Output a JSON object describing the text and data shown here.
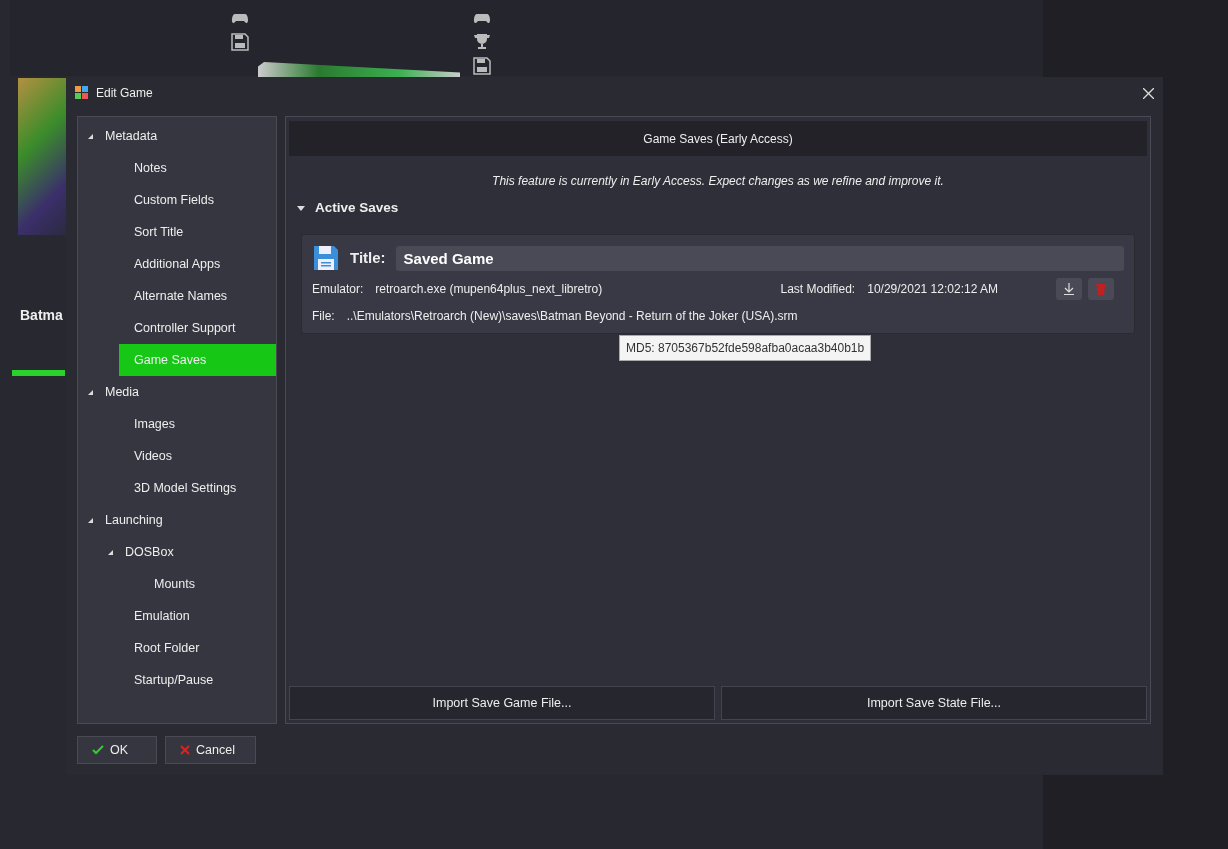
{
  "background": {
    "card_title": "Batma"
  },
  "window": {
    "title": "Edit Game"
  },
  "sidebar": {
    "items": [
      {
        "label": "Metadata",
        "expanded": true,
        "selected": false,
        "children": [
          {
            "label": "Notes",
            "selected": false
          },
          {
            "label": "Custom Fields",
            "selected": false
          },
          {
            "label": "Sort Title",
            "selected": false
          },
          {
            "label": "Additional Apps",
            "selected": false
          },
          {
            "label": "Alternate Names",
            "selected": false
          },
          {
            "label": "Controller Support",
            "selected": false
          },
          {
            "label": "Game Saves",
            "selected": true
          }
        ]
      },
      {
        "label": "Media",
        "expanded": true,
        "selected": false,
        "children": [
          {
            "label": "Images",
            "selected": false
          },
          {
            "label": "Videos",
            "selected": false
          },
          {
            "label": "3D Model Settings",
            "selected": false
          }
        ]
      },
      {
        "label": "Launching",
        "expanded": true,
        "selected": false,
        "children": [
          {
            "label": "DOSBox",
            "expanded": true,
            "selected": false,
            "children": [
              {
                "label": "Mounts",
                "selected": false
              }
            ]
          },
          {
            "label": "Emulation",
            "selected": false
          },
          {
            "label": "Root Folder",
            "selected": false
          },
          {
            "label": "Startup/Pause",
            "selected": false
          }
        ]
      }
    ]
  },
  "panel": {
    "header": "Game Saves (Early Access)",
    "notice": "This feature is currently in Early Access. Expect changes as we refine and improve it.",
    "section": {
      "label": "Active Saves",
      "expanded": true
    },
    "saves": [
      {
        "title_label": "Title:",
        "title": "Saved Game",
        "emulator_label": "Emulator:",
        "emulator": "retroarch.exe (mupen64plus_next_libretro)",
        "modified_label": "Last Modified:",
        "modified": "10/29/2021 12:02:12 AM",
        "file_label": "File:",
        "file": "..\\Emulators\\Retroarch (New)\\saves\\Batman Beyond - Return of the Joker (USA).srm"
      }
    ],
    "tooltip": "MD5: 8705367b52fde598afba0acaa3b40b1b",
    "buttons": [
      "Import Save Game File...",
      "Import Save State File..."
    ]
  },
  "footer_buttons": [
    {
      "kind": "ok",
      "label": "OK"
    },
    {
      "kind": "cancel",
      "label": "Cancel"
    }
  ]
}
